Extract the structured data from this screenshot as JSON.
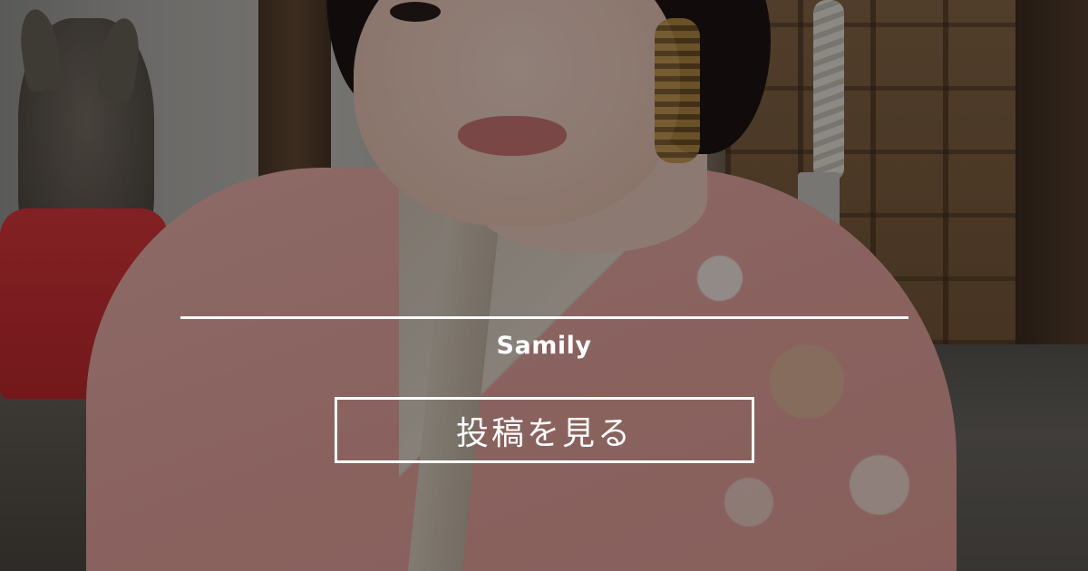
{
  "card": {
    "site_name": "Samily",
    "button_label": "投稿を見る"
  },
  "colors": {
    "text": "#ffffff",
    "overlay": "rgba(0,0,0,0.42)",
    "kimono": "#eeaca6"
  }
}
